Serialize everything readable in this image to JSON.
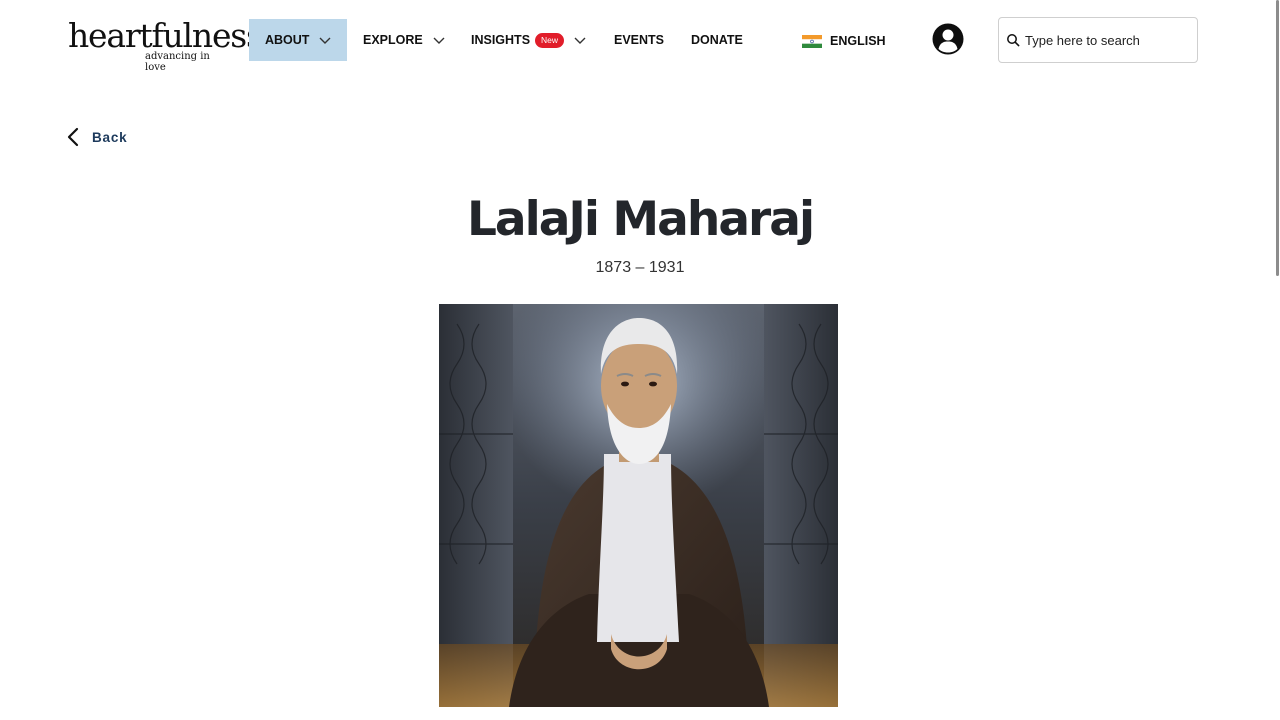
{
  "header": {
    "logo": {
      "word": "heartfulness",
      "tagline": "advancing in love"
    },
    "nav": [
      {
        "label": "ABOUT",
        "has_dropdown": true,
        "active": true
      },
      {
        "label": "EXPLORE",
        "has_dropdown": true,
        "active": false
      },
      {
        "label": "INSIGHTS",
        "badge": "New",
        "has_dropdown": true,
        "active": false
      },
      {
        "label": "EVENTS",
        "has_dropdown": false,
        "active": false
      },
      {
        "label": "DONATE",
        "has_dropdown": false,
        "active": false
      }
    ],
    "language": {
      "label": "ENGLISH",
      "flag_icon": "india-flag-icon"
    },
    "account_icon": "user-avatar-icon",
    "search": {
      "placeholder": "Type here to search",
      "value": ""
    }
  },
  "page": {
    "back_label": "Back",
    "title": "LalaJi Maharaj",
    "years": "1873 – 1931",
    "portrait_alt": "portrait"
  },
  "colors": {
    "active_nav_bg": "#bcd7ea",
    "badge_red": "#e11d2a",
    "back_text": "#1d3a5c",
    "title_text": "#23262b"
  }
}
